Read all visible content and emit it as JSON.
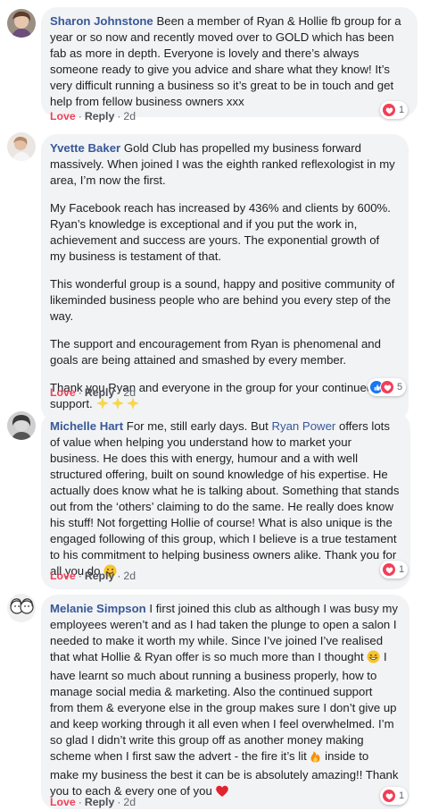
{
  "colors": {
    "author": "#385898",
    "love": "#f33e58",
    "bubble": "#f2f3f5",
    "like": "#1877f2"
  },
  "action_labels": {
    "love": "Love",
    "separator": "·",
    "reply": "Reply"
  },
  "comments": [
    {
      "author": "Sharon Johnstone",
      "paragraphs": [
        "Been a member of Ryan & Hollie fb group for a year or so now and recently moved over to GOLD which has been fab as more in depth. Everyone is lovely and there’s always someone ready to give you advice and share what they know! It’s very difficult running a business so it’s great to be in touch and get help from fellow business owners xxx"
      ],
      "time": "2d",
      "reactions": {
        "icons": [
          "heart-icon"
        ],
        "count": "1"
      }
    },
    {
      "author": "Yvette Baker",
      "paragraphs": [
        "Gold Club has propelled my business forward massively. When joined I was the eighth ranked reflexologist in my area, I’m now the first.",
        "My Facebook reach has increased by 436% and clients by 600%. Ryan’s knowledge is exceptional and if you put the work in, achievement and success are yours. The exponential growth of my business is testament of that.",
        "This wonderful group is a sound, happy and positive community of likeminded business people who are behind you every step of the way.",
        "The support and encouragement from Ryan is phenomenal and goals are being attained and smashed by every member.",
        "Thank you Ryan and everyone in the group for your continued support."
      ],
      "time": "2d",
      "reactions": {
        "icons": [
          "like-icon",
          "heart-icon"
        ],
        "count": "5"
      }
    },
    {
      "author": "Michelle Hart",
      "text_before": "For me, still early days. But",
      "mention": "Ryan Power",
      "text_after": "offers lots of value when helping you understand how to market your business. He does this with energy, humour and a with well structured offering, built on sound knowledge of his expertise. He actually does know what he is talking about. Something that stands out from the ‘others’ claiming to do the same. He really does know his stuff! Not forgetting Hollie of course! What is also unique is the engaged following of this group, which I believe is a true testament to his commitment to helping business owners alike. Thank you for all you do",
      "time": "2d",
      "reactions": {
        "icons": [
          "heart-icon"
        ],
        "count": "1"
      }
    },
    {
      "author": "Melanie Simpson",
      "text_part1": "I first joined this club as although I was busy my employees weren’t and as I had taken the plunge to open a salon I needed to make it worth my while. Since I’ve joined I’ve realised that what Hollie & Ryan offer is so much more than I thought",
      "text_part2": "I have learnt so much about running a business properly, how to manage social media & marketing. Also the continued support from them & everyone else in the group makes sure I don’t give up and keep working through it all even when I feel overwhelmed. I’m so glad I didn’t write this group off as another money making scheme when I first saw the advert - the fire it’s lit",
      "text_part3": "inside to make my business the best it can be is absolutely amazing!! Thank you to each & every one of you",
      "time": "2d",
      "reactions": {
        "icons": [
          "heart-icon"
        ],
        "count": "1"
      }
    }
  ]
}
